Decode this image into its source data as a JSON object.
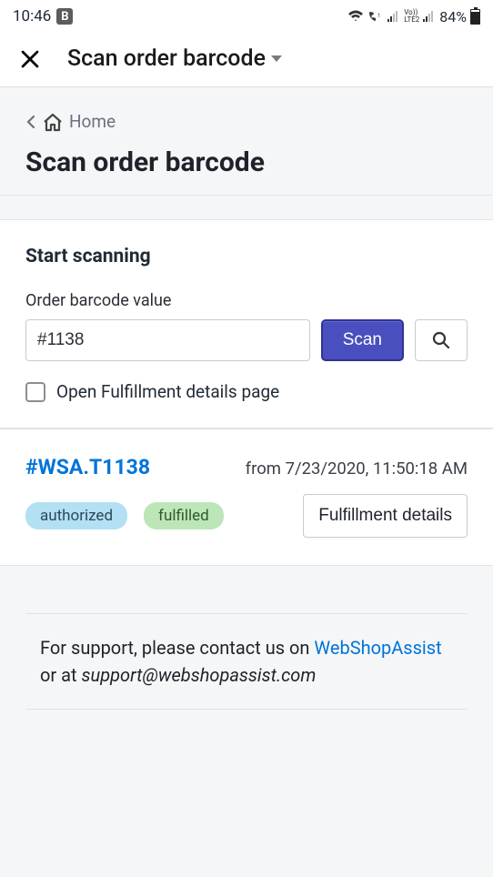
{
  "status": {
    "time": "10:46",
    "battery": "84%"
  },
  "header": {
    "title": "Scan order barcode"
  },
  "breadcrumb": {
    "home": "Home"
  },
  "page": {
    "title": "Scan order barcode"
  },
  "scan": {
    "section_title": "Start scanning",
    "field_label": "Order barcode value",
    "value": "#1138",
    "scan_button": "Scan",
    "open_fulfillment_label": "Open Fulfillment details page"
  },
  "order": {
    "name": "#WSA.T1138",
    "date_prefix": "from ",
    "date": "7/23/2020, 11:50:18 AM",
    "badge_authorized": "authorized",
    "badge_fulfilled": "fulfilled",
    "fulfillment_button": "Fulfillment details"
  },
  "support": {
    "text_prefix": "For support, please contact us on ",
    "link_text": "WebShopAssist",
    "text_mid": " or at ",
    "email": "support@webshopassist.com"
  }
}
